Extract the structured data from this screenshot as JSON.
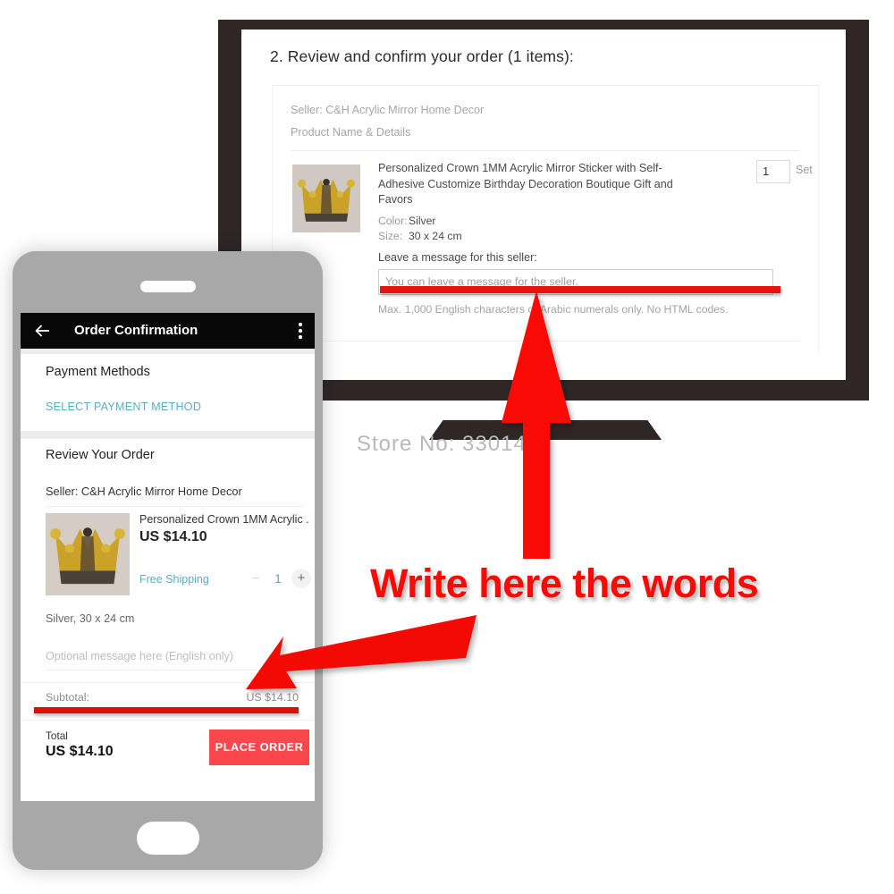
{
  "desktop": {
    "section_title": "2. Review and confirm your order (1 items):",
    "seller_line": "Seller: C&H Acrylic Mirror Home Decor",
    "column_header": "Product Name & Details",
    "product_name": "Personalized Crown 1MM Acrylic Mirror Sticker with Self-Adhesive Customize Birthday Decoration Boutique Gift and Favors",
    "color_label": "Color:",
    "color_value": "Silver",
    "size_label": "Size:",
    "size_value": "30 x 24 cm",
    "quantity": "1",
    "unit": "Set",
    "message_label": "Leave a message for this seller:",
    "message_placeholder": "You can leave a message for the seller.",
    "message_value": "",
    "message_hint": "Max. 1,000 English characters or Arabic numerals only. No HTML codes."
  },
  "watermark": {
    "store_no": "Store No: 330147"
  },
  "phone": {
    "appbar": {
      "back_icon": "back-arrow-icon",
      "title": "Order Confirmation",
      "overflow_icon": "more-vertical-icon"
    },
    "payment": {
      "title": "Payment Methods",
      "select_link": "SELECT PAYMENT METHOD"
    },
    "review": {
      "title": "Review Your Order",
      "seller": "Seller: C&H Acrylic Mirror Home Decor",
      "product_name": "Personalized Crown 1MM Acrylic ...",
      "price": "US $14.10",
      "shipping": "Free Shipping",
      "stepper": {
        "minus": "−",
        "value": "1",
        "plus": "+"
      },
      "variant": "Silver, 30 x 24 cm",
      "message_placeholder": "Optional message here (English only)",
      "message_value": "",
      "subtotal_label": "Subtotal:",
      "subtotal_value": "US $14.10"
    },
    "totals": {
      "total_label": "Total",
      "total_value": "US $14.10",
      "place_order": "PLACE ORDER"
    }
  },
  "annotation": {
    "callout_text": "Write here the words",
    "arrow_up_name": "red-up-arrow",
    "arrow_downleft_name": "red-down-left-arrow",
    "highlight_color": "#e8130f",
    "callout_color": "#f60b06"
  },
  "colors": {
    "accent_red": "#f9474c",
    "link_blue": "#5aaec4",
    "bezel": "#2e2726",
    "phone_body": "#a8a8a8"
  }
}
